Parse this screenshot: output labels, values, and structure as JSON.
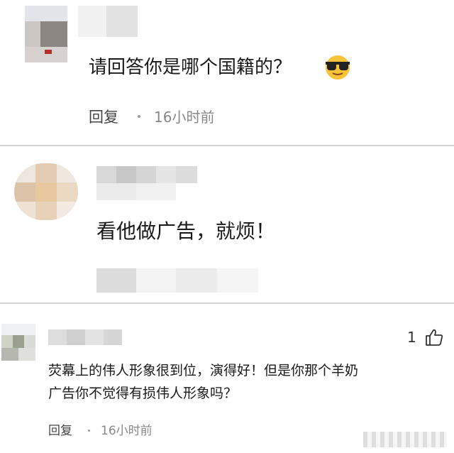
{
  "comments": [
    {
      "text": "请回答你是哪个国籍的？",
      "emoji": "sunglasses-emoji",
      "reply_label": "回复",
      "time": "16小时前"
    },
    {
      "text": "看他做广告，就烦！"
    },
    {
      "like_count": "1",
      "text_line1": "荧幕上的伟人形象很到位，演得好！但是你那个羊奶",
      "text_line2": "广告你不觉得有损伟人形象吗？",
      "reply_label": "回复",
      "time": "16小时前"
    }
  ]
}
